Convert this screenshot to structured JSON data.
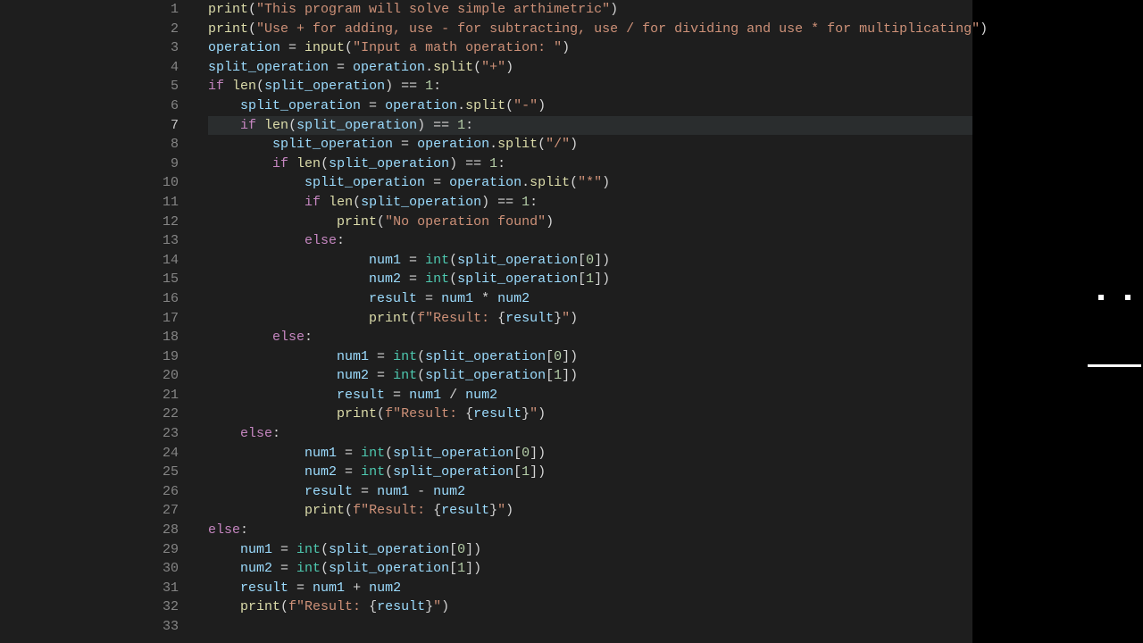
{
  "editor": {
    "highlightedLine": 7,
    "lines": [
      {
        "num": "1",
        "indent": 0,
        "tokens": [
          [
            "fn",
            "print"
          ],
          [
            "op",
            "("
          ],
          [
            "s",
            "\"This program will solve simple arthimetric\""
          ],
          [
            "op",
            ")"
          ]
        ]
      },
      {
        "num": "2",
        "indent": 0,
        "tokens": [
          [
            "fn",
            "print"
          ],
          [
            "op",
            "("
          ],
          [
            "s",
            "\"Use + for adding, use - for subtracting, use / for dividing and use * for multiplicating\""
          ],
          [
            "op",
            ")"
          ]
        ]
      },
      {
        "num": "3",
        "indent": 0,
        "tokens": [
          [
            "v",
            "operation"
          ],
          [
            "op",
            " = "
          ],
          [
            "fn",
            "input"
          ],
          [
            "op",
            "("
          ],
          [
            "s",
            "\"Input a math operation: \""
          ],
          [
            "op",
            ")"
          ]
        ]
      },
      {
        "num": "4",
        "indent": 0,
        "tokens": [
          [
            "v",
            "split_operation"
          ],
          [
            "op",
            " = "
          ],
          [
            "v",
            "operation"
          ],
          [
            "op",
            "."
          ],
          [
            "fn",
            "split"
          ],
          [
            "op",
            "("
          ],
          [
            "s",
            "\"+\""
          ],
          [
            "op",
            ")"
          ]
        ]
      },
      {
        "num": "5",
        "indent": 0,
        "tokens": [
          [
            "k",
            "if"
          ],
          [
            "op",
            " "
          ],
          [
            "fn",
            "len"
          ],
          [
            "op",
            "("
          ],
          [
            "v",
            "split_operation"
          ],
          [
            "op",
            ") == "
          ],
          [
            "n",
            "1"
          ],
          [
            "op",
            ":"
          ]
        ]
      },
      {
        "num": "6",
        "indent": 1,
        "tokens": [
          [
            "v",
            "split_operation"
          ],
          [
            "op",
            " = "
          ],
          [
            "v",
            "operation"
          ],
          [
            "op",
            "."
          ],
          [
            "fn",
            "split"
          ],
          [
            "op",
            "("
          ],
          [
            "s",
            "\"-\""
          ],
          [
            "op",
            ")"
          ]
        ]
      },
      {
        "num": "7",
        "indent": 1,
        "tokens": [
          [
            "k",
            "if"
          ],
          [
            "op",
            " "
          ],
          [
            "fn",
            "len"
          ],
          [
            "op",
            "("
          ],
          [
            "v",
            "split_operation"
          ],
          [
            "op",
            ") == "
          ],
          [
            "n",
            "1"
          ],
          [
            "op",
            ":"
          ]
        ]
      },
      {
        "num": "8",
        "indent": 2,
        "tokens": [
          [
            "v",
            "split_operation"
          ],
          [
            "op",
            " = "
          ],
          [
            "v",
            "operation"
          ],
          [
            "op",
            "."
          ],
          [
            "fn",
            "split"
          ],
          [
            "op",
            "("
          ],
          [
            "s",
            "\"/\""
          ],
          [
            "op",
            ")"
          ]
        ]
      },
      {
        "num": "9",
        "indent": 2,
        "tokens": [
          [
            "k",
            "if"
          ],
          [
            "op",
            " "
          ],
          [
            "fn",
            "len"
          ],
          [
            "op",
            "("
          ],
          [
            "v",
            "split_operation"
          ],
          [
            "op",
            ") == "
          ],
          [
            "n",
            "1"
          ],
          [
            "op",
            ":"
          ]
        ]
      },
      {
        "num": "10",
        "indent": 3,
        "tokens": [
          [
            "v",
            "split_operation"
          ],
          [
            "op",
            " = "
          ],
          [
            "v",
            "operation"
          ],
          [
            "op",
            "."
          ],
          [
            "fn",
            "split"
          ],
          [
            "op",
            "("
          ],
          [
            "s",
            "\"*\""
          ],
          [
            "op",
            ")"
          ]
        ]
      },
      {
        "num": "11",
        "indent": 3,
        "tokens": [
          [
            "k",
            "if"
          ],
          [
            "op",
            " "
          ],
          [
            "fn",
            "len"
          ],
          [
            "op",
            "("
          ],
          [
            "v",
            "split_operation"
          ],
          [
            "op",
            ") == "
          ],
          [
            "n",
            "1"
          ],
          [
            "op",
            ":"
          ]
        ]
      },
      {
        "num": "12",
        "indent": 4,
        "tokens": [
          [
            "fn",
            "print"
          ],
          [
            "op",
            "("
          ],
          [
            "s",
            "\"No operation found\""
          ],
          [
            "op",
            ")"
          ]
        ]
      },
      {
        "num": "13",
        "indent": 3,
        "tokens": [
          [
            "k",
            "else"
          ],
          [
            "op",
            ":"
          ]
        ]
      },
      {
        "num": "14",
        "indent": 5,
        "tokens": [
          [
            "v",
            "num1"
          ],
          [
            "op",
            " = "
          ],
          [
            "bi",
            "int"
          ],
          [
            "op",
            "("
          ],
          [
            "v",
            "split_operation"
          ],
          [
            "op",
            "["
          ],
          [
            "n",
            "0"
          ],
          [
            "op",
            "])"
          ]
        ]
      },
      {
        "num": "15",
        "indent": 5,
        "tokens": [
          [
            "v",
            "num2"
          ],
          [
            "op",
            " = "
          ],
          [
            "bi",
            "int"
          ],
          [
            "op",
            "("
          ],
          [
            "v",
            "split_operation"
          ],
          [
            "op",
            "["
          ],
          [
            "n",
            "1"
          ],
          [
            "op",
            "])"
          ]
        ]
      },
      {
        "num": "16",
        "indent": 5,
        "tokens": [
          [
            "v",
            "result"
          ],
          [
            "op",
            " = "
          ],
          [
            "v",
            "num1"
          ],
          [
            "op",
            " * "
          ],
          [
            "v",
            "num2"
          ]
        ]
      },
      {
        "num": "17",
        "indent": 5,
        "tokens": [
          [
            "fn",
            "print"
          ],
          [
            "op",
            "("
          ],
          [
            "s",
            "f\"Result: "
          ],
          [
            "op",
            "{"
          ],
          [
            "v",
            "result"
          ],
          [
            "op",
            "}"
          ],
          [
            "s",
            "\""
          ],
          [
            "op",
            ")"
          ]
        ]
      },
      {
        "num": "18",
        "indent": 2,
        "tokens": [
          [
            "k",
            "else"
          ],
          [
            "op",
            ":"
          ]
        ]
      },
      {
        "num": "19",
        "indent": 4,
        "tokens": [
          [
            "v",
            "num1"
          ],
          [
            "op",
            " = "
          ],
          [
            "bi",
            "int"
          ],
          [
            "op",
            "("
          ],
          [
            "v",
            "split_operation"
          ],
          [
            "op",
            "["
          ],
          [
            "n",
            "0"
          ],
          [
            "op",
            "])"
          ]
        ]
      },
      {
        "num": "20",
        "indent": 4,
        "tokens": [
          [
            "v",
            "num2"
          ],
          [
            "op",
            " = "
          ],
          [
            "bi",
            "int"
          ],
          [
            "op",
            "("
          ],
          [
            "v",
            "split_operation"
          ],
          [
            "op",
            "["
          ],
          [
            "n",
            "1"
          ],
          [
            "op",
            "])"
          ]
        ]
      },
      {
        "num": "21",
        "indent": 4,
        "tokens": [
          [
            "v",
            "result"
          ],
          [
            "op",
            " = "
          ],
          [
            "v",
            "num1"
          ],
          [
            "op",
            " / "
          ],
          [
            "v",
            "num2"
          ]
        ]
      },
      {
        "num": "22",
        "indent": 4,
        "tokens": [
          [
            "fn",
            "print"
          ],
          [
            "op",
            "("
          ],
          [
            "s",
            "f\"Result: "
          ],
          [
            "op",
            "{"
          ],
          [
            "v",
            "result"
          ],
          [
            "op",
            "}"
          ],
          [
            "s",
            "\""
          ],
          [
            "op",
            ")"
          ]
        ]
      },
      {
        "num": "23",
        "indent": 1,
        "tokens": [
          [
            "k",
            "else"
          ],
          [
            "op",
            ":"
          ]
        ]
      },
      {
        "num": "24",
        "indent": 3,
        "tokens": [
          [
            "v",
            "num1"
          ],
          [
            "op",
            " = "
          ],
          [
            "bi",
            "int"
          ],
          [
            "op",
            "("
          ],
          [
            "v",
            "split_operation"
          ],
          [
            "op",
            "["
          ],
          [
            "n",
            "0"
          ],
          [
            "op",
            "])"
          ]
        ]
      },
      {
        "num": "25",
        "indent": 3,
        "tokens": [
          [
            "v",
            "num2"
          ],
          [
            "op",
            " = "
          ],
          [
            "bi",
            "int"
          ],
          [
            "op",
            "("
          ],
          [
            "v",
            "split_operation"
          ],
          [
            "op",
            "["
          ],
          [
            "n",
            "1"
          ],
          [
            "op",
            "])"
          ]
        ]
      },
      {
        "num": "26",
        "indent": 3,
        "tokens": [
          [
            "v",
            "result"
          ],
          [
            "op",
            " = "
          ],
          [
            "v",
            "num1"
          ],
          [
            "op",
            " - "
          ],
          [
            "v",
            "num2"
          ]
        ]
      },
      {
        "num": "27",
        "indent": 3,
        "tokens": [
          [
            "fn",
            "print"
          ],
          [
            "op",
            "("
          ],
          [
            "s",
            "f\"Result: "
          ],
          [
            "op",
            "{"
          ],
          [
            "v",
            "result"
          ],
          [
            "op",
            "}"
          ],
          [
            "s",
            "\""
          ],
          [
            "op",
            ")"
          ]
        ]
      },
      {
        "num": "28",
        "indent": 0,
        "tokens": [
          [
            "k",
            "else"
          ],
          [
            "op",
            ":"
          ]
        ]
      },
      {
        "num": "29",
        "indent": 1,
        "tokens": [
          [
            "v",
            "num1"
          ],
          [
            "op",
            " = "
          ],
          [
            "bi",
            "int"
          ],
          [
            "op",
            "("
          ],
          [
            "v",
            "split_operation"
          ],
          [
            "op",
            "["
          ],
          [
            "n",
            "0"
          ],
          [
            "op",
            "])"
          ]
        ]
      },
      {
        "num": "30",
        "indent": 1,
        "tokens": [
          [
            "v",
            "num2"
          ],
          [
            "op",
            " = "
          ],
          [
            "bi",
            "int"
          ],
          [
            "op",
            "("
          ],
          [
            "v",
            "split_operation"
          ],
          [
            "op",
            "["
          ],
          [
            "n",
            "1"
          ],
          [
            "op",
            "])"
          ]
        ]
      },
      {
        "num": "31",
        "indent": 1,
        "tokens": [
          [
            "v",
            "result"
          ],
          [
            "op",
            " = "
          ],
          [
            "v",
            "num1"
          ],
          [
            "op",
            " + "
          ],
          [
            "v",
            "num2"
          ]
        ]
      },
      {
        "num": "32",
        "indent": 1,
        "tokens": [
          [
            "fn",
            "print"
          ],
          [
            "op",
            "("
          ],
          [
            "s",
            "f\"Result: "
          ],
          [
            "op",
            "{"
          ],
          [
            "v",
            "result"
          ],
          [
            "op",
            "}"
          ],
          [
            "s",
            "\""
          ],
          [
            "op",
            ")"
          ]
        ]
      },
      {
        "num": "33",
        "indent": 0,
        "tokens": []
      }
    ]
  }
}
